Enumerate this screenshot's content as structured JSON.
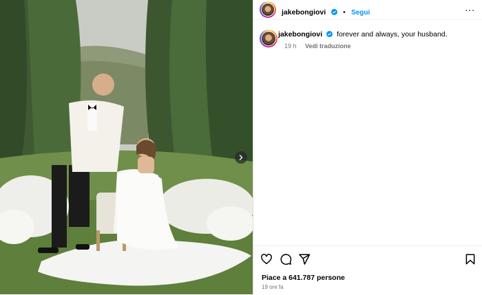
{
  "post": {
    "username": "jakebongiovi",
    "follow_label": "Segui",
    "separator": "•",
    "more_label": "...",
    "caption": "forever and always, your husband.",
    "caption_age": "19 h",
    "translate_label": "Vedi traduzione",
    "likes": "Piace a 641.787 persone",
    "timestamp": "19 ore fa"
  },
  "icons": {
    "like": "heart-icon",
    "comment": "comment-icon",
    "share": "share-icon",
    "save": "bookmark-icon",
    "next": "chevron-right-icon",
    "verified": "verified-badge-icon"
  },
  "colors": {
    "accent": "#0095f6",
    "verified": "#0095f6",
    "muted_text": "#737373",
    "divider": "#dbdbdb"
  }
}
